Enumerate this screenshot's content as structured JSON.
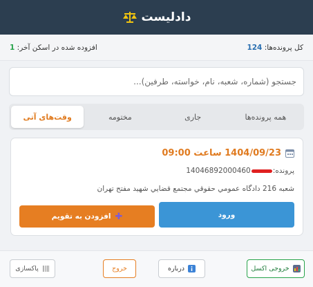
{
  "header": {
    "title": "دادلیست",
    "icon": "scale-icon"
  },
  "stats": {
    "total_label": "کل پرونده‌ها:",
    "total_value": "124",
    "added_label": "افزوده شده در اسکن آخر:",
    "added_value": "1"
  },
  "search": {
    "placeholder": "جستجو (شماره، شعبه، نام، خواسته، طرفین)..."
  },
  "tabs": [
    {
      "label": "همه پرونده‌ها"
    },
    {
      "label": "جاری"
    },
    {
      "label": "مختومه"
    },
    {
      "label": "وقت‌های آتی",
      "active": true
    }
  ],
  "card": {
    "date_text": "1404/09/23 ساعت 09:00",
    "case_label": "پرونده:",
    "case_number": "14046892000460",
    "branch": "شعبه 216 دادگاه عمومي حقوقي مجتمع قضايي شهيد مفتح تهران",
    "enter_button": "ورود",
    "add_calendar_button": "افزودن به تقویم"
  },
  "footer": {
    "excel": "خروجی اکسل",
    "about": "درباره",
    "exit": "خروج",
    "clear": "پاکسازی"
  },
  "colors": {
    "header_bg": "#2c3e50",
    "accent_orange": "#e67e22",
    "accent_blue": "#3b95d6",
    "success_green": "#27a34a"
  }
}
